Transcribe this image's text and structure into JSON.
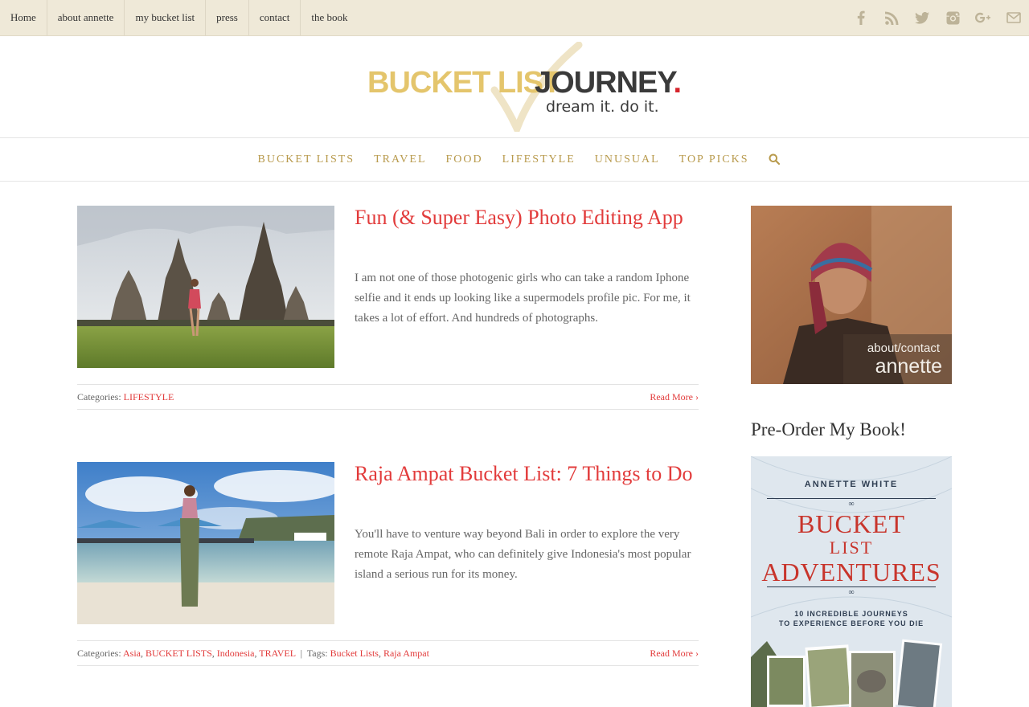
{
  "topnav": {
    "items": [
      "Home",
      "about annette",
      "my bucket list",
      "press",
      "contact",
      "the book"
    ]
  },
  "social": {
    "icons": [
      "facebook-icon",
      "rss-icon",
      "twitter-icon",
      "instagram-icon",
      "google-plus-icon",
      "mail-icon"
    ]
  },
  "logo": {
    "part1": "BUCKET LIST",
    "part2": "JOURNEY",
    "dot": ".",
    "tagline": "dream it. do it."
  },
  "mainnav": {
    "items": [
      "BUCKET LISTS",
      "TRAVEL",
      "FOOD",
      "LIFESTYLE",
      "UNUSUAL",
      "TOP PICKS"
    ],
    "search_icon": "search-icon"
  },
  "posts": [
    {
      "title": "Fun (& Super Easy) Photo Editing App",
      "excerpt": "I am not one of those photogenic girls who can take a random Iphone selfie and it ends up looking like a supermodels profile pic. For me, it takes a lot of effort. And hundreds of photographs.",
      "categories_label": "Categories:",
      "categories": [
        "LIFESTYLE"
      ],
      "read_more": "Read More"
    },
    {
      "title": "Raja Ampat Bucket List: 7 Things to Do",
      "excerpt": "You'll have to venture way beyond Bali in order to explore the very remote Raja Ampat, who can definitely give Indonesia's most popular island a serious run for its money.",
      "categories_label": "Categories:",
      "categories": [
        "Asia",
        "BUCKET LISTS",
        "Indonesia",
        "TRAVEL"
      ],
      "tags_label": "Tags:",
      "tags": [
        "Bucket Lists",
        "Raja Ampat"
      ],
      "read_more": "Read More"
    }
  ],
  "sidebar": {
    "profile_caption_1": "about/contact",
    "profile_caption_2": "annette",
    "heading": "Pre-Order My Book!",
    "book": {
      "author": "ANNETTE WHITE",
      "title_1": "BUCKET",
      "title_2": "LIST",
      "title_3": "ADVENTURES",
      "subtitle_1": "10 INCREDIBLE JOURNEYS",
      "subtitle_2": "TO EXPERIENCE BEFORE YOU DIE"
    }
  },
  "colors": {
    "accent_red": "#e23b3b",
    "nav_gold": "#b89a4c",
    "topbar_bg": "#efe9d8"
  }
}
